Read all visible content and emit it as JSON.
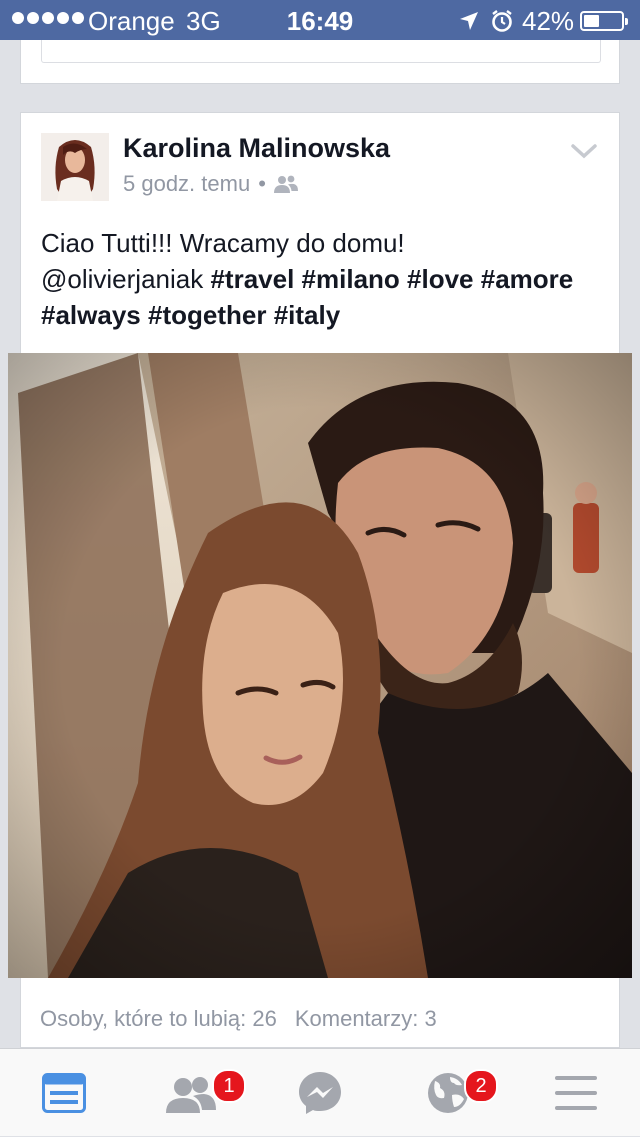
{
  "status_bar": {
    "carrier": "Orange",
    "network": "3G",
    "time": "16:49",
    "battery": "42%",
    "battery_level": 0.42
  },
  "post": {
    "author": "Karolina Malinowska",
    "timestamp": "5 godz. temu",
    "separator": "•",
    "audience_icon": "friends-icon",
    "text_line1": "Ciao Tutti!!! Wracamy do domu!",
    "text_mention": "@olivierjaniak",
    "hashtags_line2": [
      "#travel",
      "#milano",
      "#love",
      "#amore"
    ],
    "hashtags_line3": [
      "#always",
      "#together",
      "#italy"
    ],
    "likes": "Osoby, które to lubią: 26",
    "comments": "Komentarzy: 3"
  },
  "tab_bar": {
    "items": [
      {
        "icon": "news-feed-icon",
        "active": true,
        "badge": ""
      },
      {
        "icon": "friend-requests-icon",
        "active": false,
        "badge": "1"
      },
      {
        "icon": "messenger-icon",
        "active": false,
        "badge": ""
      },
      {
        "icon": "notifications-globe-icon",
        "active": false,
        "badge": "2"
      },
      {
        "icon": "more-menu-icon",
        "active": false,
        "badge": ""
      }
    ]
  },
  "colors": {
    "brand": "#4e69a2",
    "active_tab": "#4a90e2",
    "inactive_tab": "#a4a7ae",
    "badge": "#e5161d",
    "meta_text": "#9197a3"
  }
}
